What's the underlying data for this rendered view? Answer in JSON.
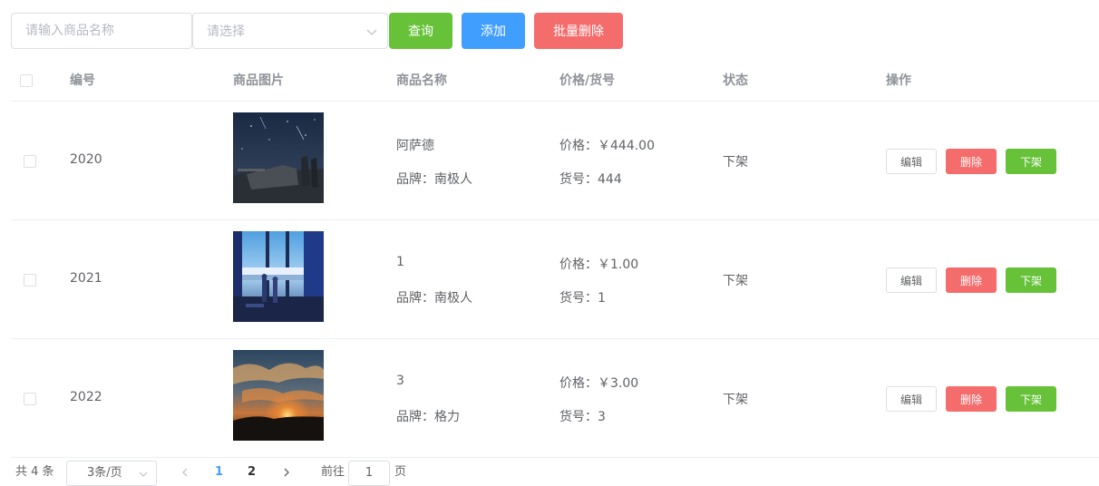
{
  "toolbar": {
    "search_placeholder": "请输入商品名称",
    "select_placeholder": "请选择",
    "query_label": "查询",
    "add_label": "添加",
    "batch_delete_label": "批量删除"
  },
  "table": {
    "headers": {
      "id": "编号",
      "image": "商品图片",
      "name": "商品名称",
      "price_sku": "价格/货号",
      "status": "状态",
      "actions": "操作"
    },
    "rows": [
      {
        "id": "2020",
        "name": "阿萨德",
        "brand": "品牌：南极人",
        "price": "价格：￥444.00",
        "sku": "货号：444",
        "status": "下架",
        "image": "tank-night-sky-image"
      },
      {
        "id": "2021",
        "name": "1",
        "brand": "品牌：南极人",
        "price": "价格：￥1.00",
        "sku": "货号：1",
        "status": "下架",
        "image": "window-city-view-image"
      },
      {
        "id": "2022",
        "name": "3",
        "brand": "品牌：格力",
        "price": "价格：￥3.00",
        "sku": "货号：3",
        "status": "下架",
        "image": "sunset-clouds-image"
      }
    ],
    "row_actions": {
      "edit": "编辑",
      "delete": "删除",
      "offshelf": "下架"
    }
  },
  "pagination": {
    "total": "共 4 条",
    "page_size": "3条/页",
    "pages": [
      "1",
      "2"
    ],
    "current_page": "1",
    "goto_prefix": "前往",
    "goto_value": "1",
    "goto_suffix": "页"
  },
  "colors": {
    "green": "#67c23a",
    "blue": "#409eff",
    "red": "#f56c6c",
    "border": "#dcdfe6"
  }
}
